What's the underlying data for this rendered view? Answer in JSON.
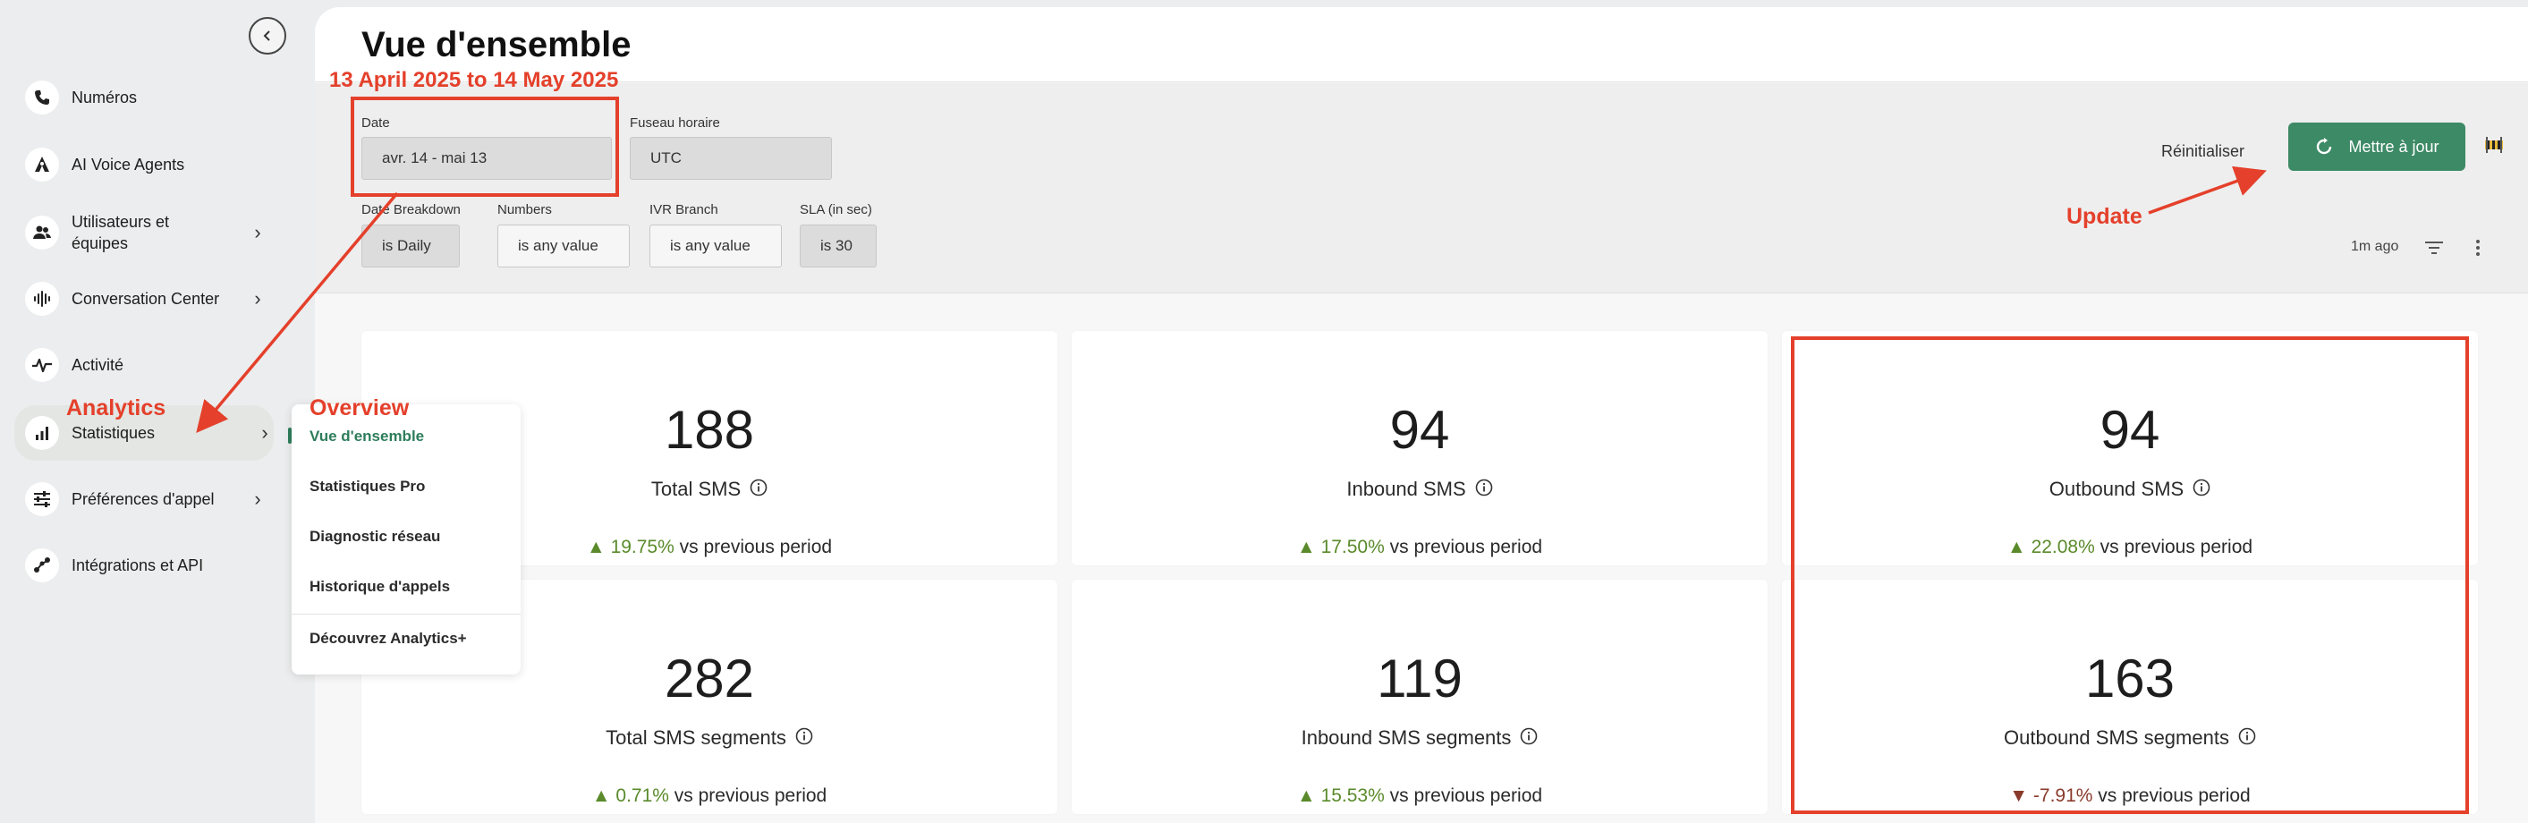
{
  "sidebar": {
    "items": [
      {
        "label": "Numéros",
        "icon": "phone-icon"
      },
      {
        "label": "AI Voice Agents",
        "icon": "ai-agent-icon"
      },
      {
        "label": "Utilisateurs et\néquipes",
        "icon": "users-icon"
      },
      {
        "label": "Conversation Center",
        "icon": "waveform-icon"
      },
      {
        "label": "Activité",
        "icon": "activity-icon"
      },
      {
        "label": "Statistiques",
        "icon": "bar-chart-icon"
      },
      {
        "label": "Préférences d'appel",
        "icon": "sliders-icon"
      },
      {
        "label": "Intégrations et API",
        "icon": "integrations-icon"
      }
    ],
    "chevron": "›"
  },
  "submenu": {
    "items": [
      "Vue d'ensemble",
      "Statistiques Pro",
      "Diagnostic réseau",
      "Historique d'appels",
      "Découvrez Analytics+"
    ]
  },
  "header": {
    "title": "Vue d'ensemble"
  },
  "filters": {
    "date_label": "Date",
    "date_value": "avr. 14 - mai 13",
    "timezone_label": "Fuseau horaire",
    "timezone_value": "UTC",
    "breakdown_label": "Date Breakdown",
    "breakdown_value": "is Daily",
    "numbers_label": "Numbers",
    "numbers_value": "is any value",
    "ivr_label": "IVR Branch",
    "ivr_value": "is any value",
    "sla_label": "SLA (in sec)",
    "sla_value": "is 30",
    "reset_label": "Réinitialiser",
    "update_label": "Mettre à jour",
    "last_updated": "1m ago"
  },
  "cards": [
    {
      "value": "188",
      "label": "Total SMS",
      "delta": "19.75%",
      "direction": "up",
      "suffix": "vs previous period"
    },
    {
      "value": "94",
      "label": "Inbound SMS",
      "delta": "17.50%",
      "direction": "up",
      "suffix": "vs previous period"
    },
    {
      "value": "94",
      "label": "Outbound SMS",
      "delta": "22.08%",
      "direction": "up",
      "suffix": "vs previous period"
    },
    {
      "value": "282",
      "label": "Total SMS segments",
      "delta": "0.71%",
      "direction": "up",
      "suffix": "vs previous period"
    },
    {
      "value": "119",
      "label": "Inbound SMS segments",
      "delta": "15.53%",
      "direction": "up",
      "suffix": "vs previous period"
    },
    {
      "value": "163",
      "label": "Outbound SMS segments",
      "delta": "-7.91%",
      "direction": "down",
      "suffix": "vs previous period"
    }
  ],
  "annotations": {
    "date_range": "13 April 2025 to 14 May 2025",
    "analytics": "Analytics",
    "overview": "Overview",
    "update": "Update"
  },
  "colors": {
    "accent": "#3d8a66",
    "annotation": "#e4402b",
    "up": "#5a8a2b",
    "down": "#8a3a2b"
  }
}
